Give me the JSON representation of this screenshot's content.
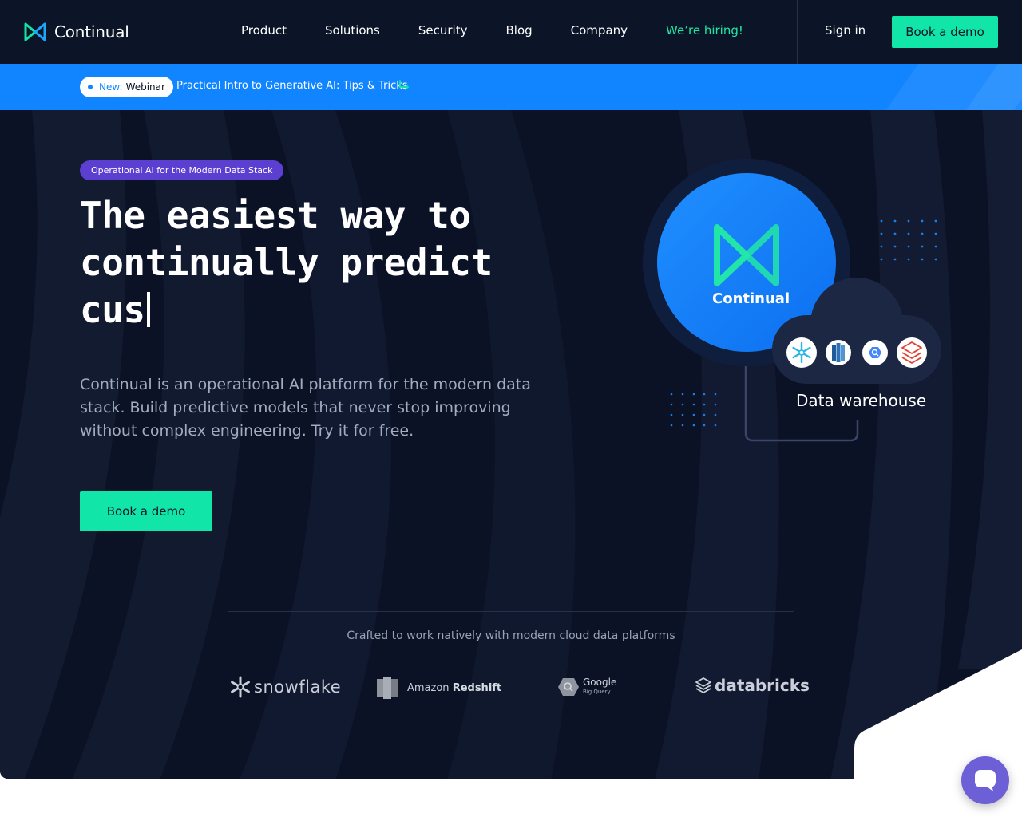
{
  "nav": {
    "brand": "Continual",
    "links": [
      "Product",
      "Solutions",
      "Security",
      "Blog",
      "Company"
    ],
    "hiring": "We’re hiring!",
    "signin": "Sign in",
    "cta": "Book a demo"
  },
  "banner": {
    "badge_new": "New:",
    "badge_type": "Webinar",
    "text": "Practical Intro to Generative AI: Tips & Tricks"
  },
  "hero": {
    "tag": "Operational AI for the Modern Data Stack",
    "headline_line1": "The easiest way to",
    "headline_line2": "continually predict",
    "headline_typed": "cus",
    "subtext": "Continual is an operational AI platform for the modern data stack. Build predictive models that never stop improving without complex engineering. Try it for free.",
    "cta": "Book a demo",
    "diagram_brand": "Continual",
    "diagram_label": "Data warehouse"
  },
  "partners": {
    "heading": "Crafted to work natively with modern cloud data platforms",
    "snowflake": "snowflake",
    "redshift_prefix": "Amazon",
    "redshift_name": "Redshift",
    "google": "Google",
    "bigquery": "Big Query",
    "databricks": "databricks"
  },
  "colors": {
    "navy": "#0c1427",
    "accent_green": "#12e5a8",
    "banner_blue": "#1184ff",
    "tag_purple": "#5b3fd0"
  },
  "icons": [
    "continual-logo-icon",
    "arrow-return-icon",
    "snowflake-icon",
    "redshift-icon",
    "bigquery-icon",
    "databricks-icon",
    "chat-icon"
  ]
}
